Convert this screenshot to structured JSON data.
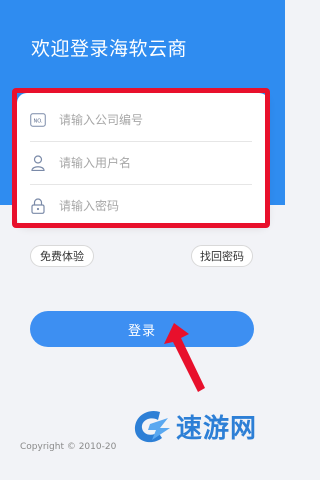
{
  "header": {
    "title": "欢迎登录海软云商"
  },
  "form": {
    "company_placeholder": "请输入公司编号",
    "company_icon_text": "NO.",
    "username_placeholder": "请输入用户名",
    "password_placeholder": "请输入密码"
  },
  "actions": {
    "trial_label": "免费体验",
    "forgot_label": "找回密码",
    "login_label": "登录"
  },
  "footer": {
    "copyright": "Copyright © 2010-20"
  },
  "watermark": {
    "text": "速游网"
  },
  "colors": {
    "primary": "#2f8cf0",
    "highlight": "#e8102c",
    "button": "#3d8ff2"
  }
}
